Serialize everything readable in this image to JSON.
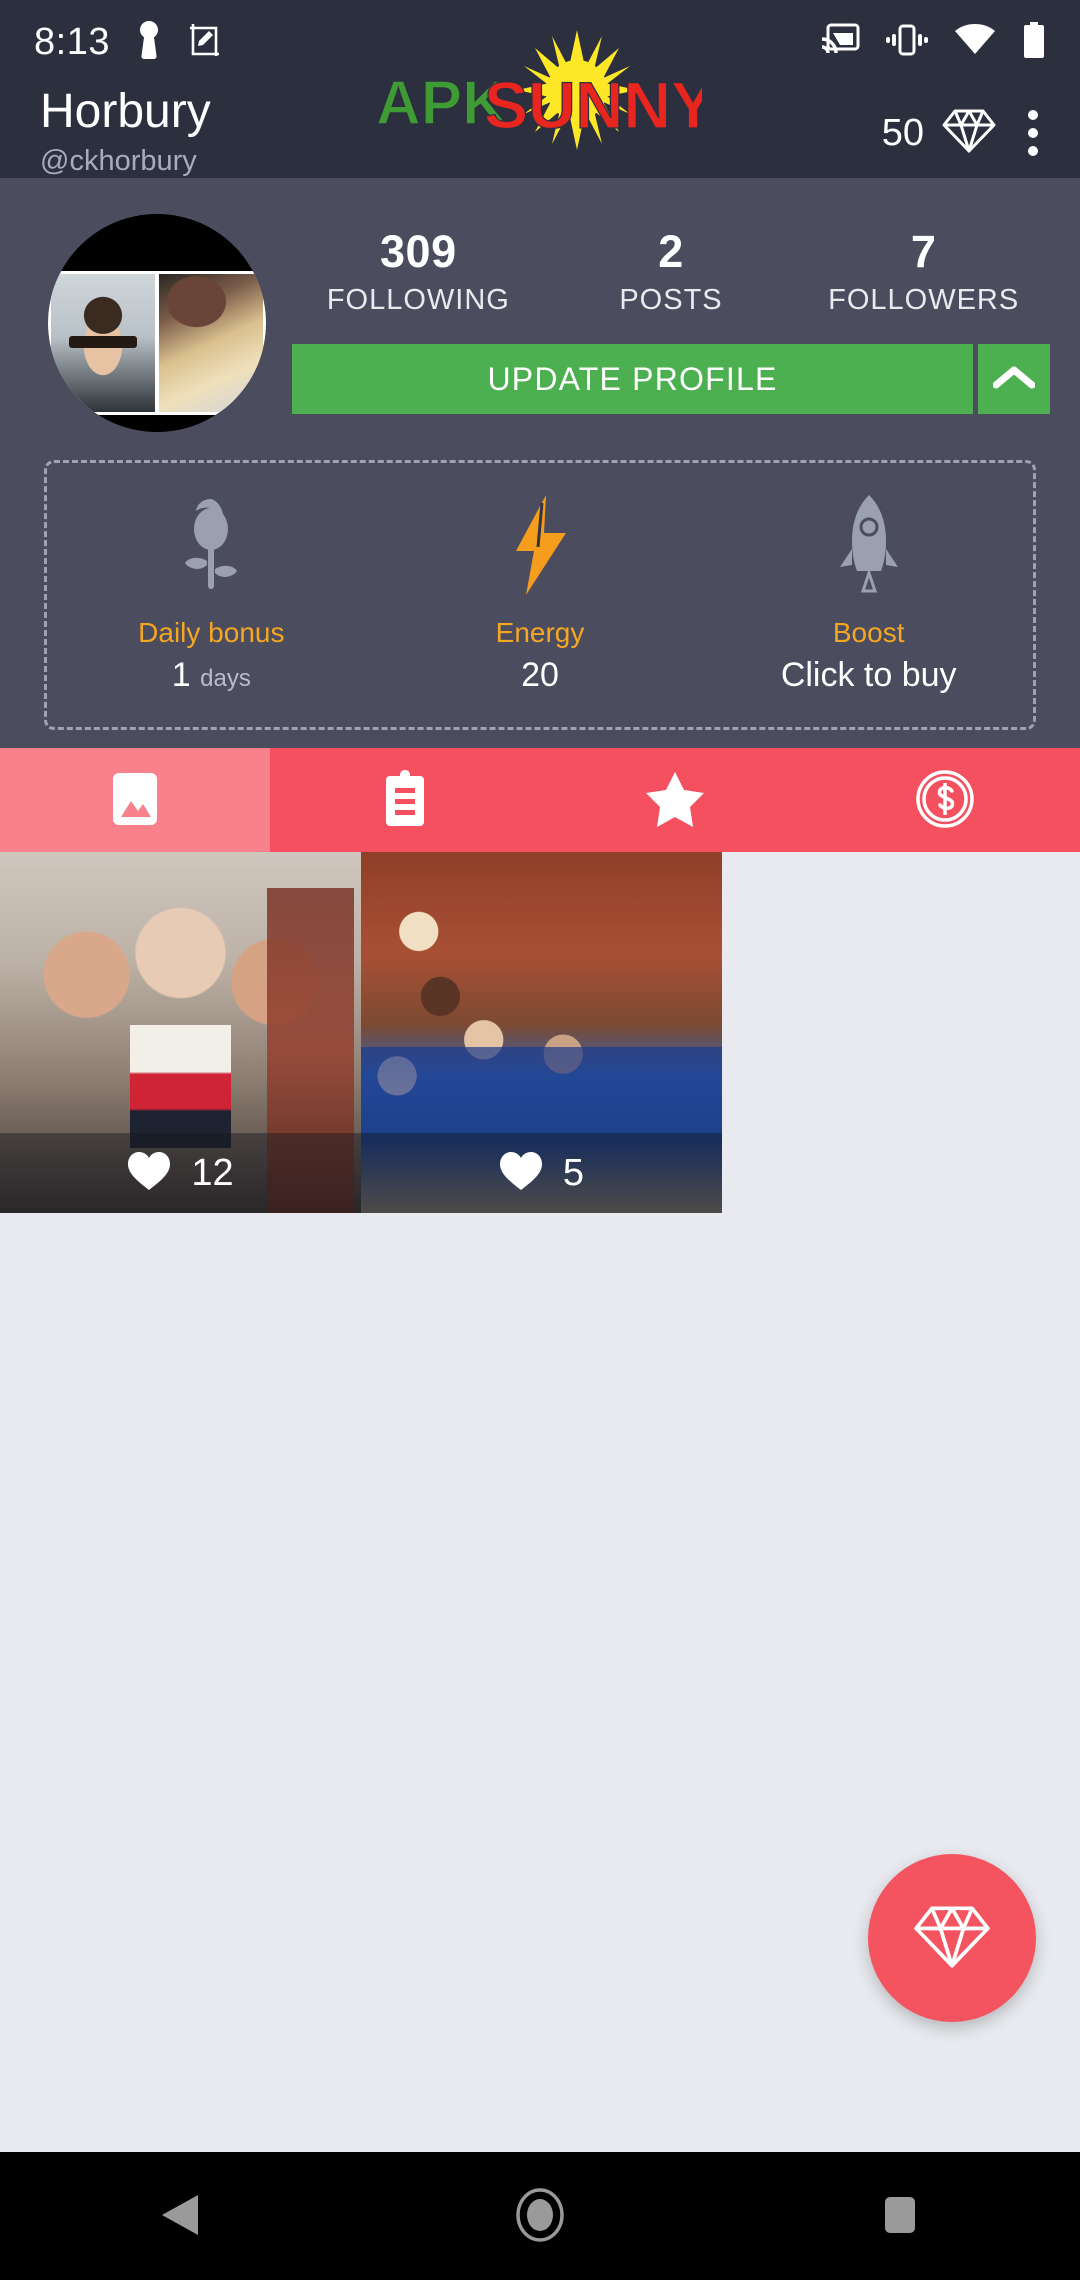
{
  "statusbar": {
    "time": "8:13",
    "left_icons": [
      "key-icon",
      "edit-crop-icon"
    ],
    "right_icons": [
      "cast-icon",
      "vibrate-icon",
      "wifi-icon",
      "battery-icon"
    ]
  },
  "watermark": {
    "text_green": "APK",
    "text_red": "SUNNY",
    "color_green": "#3f9c35",
    "color_red": "#e8251f",
    "color_sun": "#fde727"
  },
  "appbar": {
    "title": "Horbury",
    "handle": "@ckhorbury",
    "gem_count": "50",
    "gem_icon": "diamond-icon",
    "overflow_icon": "more-vertical-icon"
  },
  "profile": {
    "avatar_name": "user-avatar",
    "stats": [
      {
        "value": "309",
        "label": "FOLLOWING"
      },
      {
        "value": "2",
        "label": "POSTS"
      },
      {
        "value": "7",
        "label": "FOLLOWERS"
      }
    ],
    "update_button": "UPDATE PROFILE",
    "expand_icon": "chevron-up-icon",
    "accent_green": "#4caf50"
  },
  "bonus": {
    "items": [
      {
        "icon": "rose-icon",
        "label": "Daily bonus",
        "value": "1",
        "unit": "days"
      },
      {
        "icon": "lightning-icon",
        "label": "Energy",
        "value": "20",
        "unit": ""
      },
      {
        "icon": "rocket-icon",
        "label": "Boost",
        "value": "Click to buy",
        "unit": ""
      }
    ],
    "label_color": "#f5a623"
  },
  "tabs": [
    {
      "name": "tab-photos",
      "icon": "photo-icon",
      "active": true
    },
    {
      "name": "tab-tasks",
      "icon": "clipboard-icon",
      "active": false
    },
    {
      "name": "tab-favorites",
      "icon": "star-icon",
      "active": false
    },
    {
      "name": "tab-earnings",
      "icon": "coin-dollar-icon",
      "active": false
    }
  ],
  "tabbar_colors": {
    "active": "#f8818c",
    "inactive": "#f5505f"
  },
  "photos": [
    {
      "likes": "12",
      "like_icon": "heart-icon"
    },
    {
      "likes": "5",
      "like_icon": "heart-icon"
    }
  ],
  "fab": {
    "icon": "diamond-icon",
    "color": "#f4545f"
  },
  "navbar": {
    "buttons": [
      {
        "name": "nav-back",
        "icon": "back-triangle-icon"
      },
      {
        "name": "nav-home",
        "icon": "home-circle-icon"
      },
      {
        "name": "nav-recents",
        "icon": "recents-square-icon"
      }
    ]
  }
}
